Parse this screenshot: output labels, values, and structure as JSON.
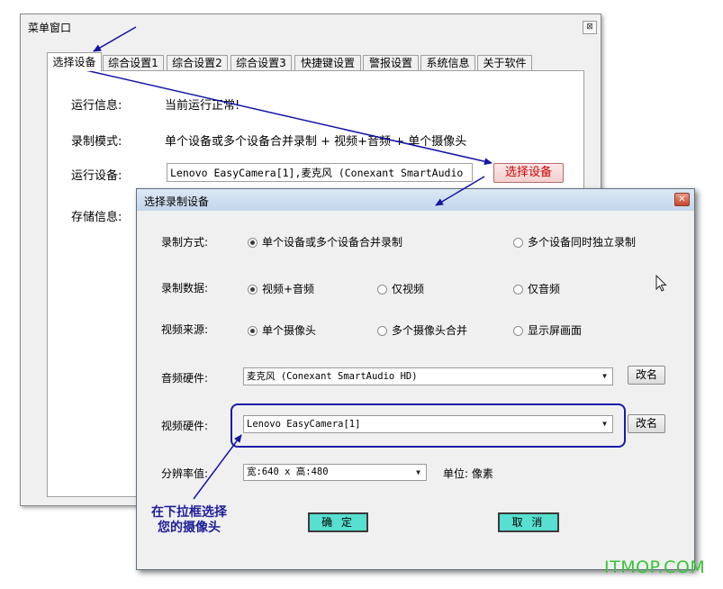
{
  "main_window": {
    "title": "菜单窗口",
    "close_glyph": "⊠",
    "tabs": [
      "选择设备",
      "综合设置1",
      "综合设置2",
      "综合设置3",
      "快捷键设置",
      "警报设置",
      "系统信息",
      "关于软件"
    ],
    "active_tab": "选择设备",
    "rows": {
      "run_info_label": "运行信息:",
      "run_info_value": "当前运行正常!",
      "record_mode_label": "录制模式:",
      "record_mode_value": "单个设备或多个设备合并录制 + 视频+音频 + 单个摄像头",
      "run_device_label": "运行设备:",
      "run_device_value": "Lenovo EasyCamera[1],麦克风 (Conexant SmartAudio",
      "storage_label": "存储信息:"
    },
    "select_device_button": "选择设备"
  },
  "dialog": {
    "title": "选择录制设备",
    "close_glyph": "✕",
    "record_method": {
      "label": "录制方式:",
      "options": [
        "单个设备或多个设备合并录制",
        "多个设备同时独立录制"
      ],
      "selected": 0
    },
    "record_data": {
      "label": "录制数据:",
      "options": [
        "视频+音频",
        "仅视频",
        "仅音频"
      ],
      "selected": 0
    },
    "video_source": {
      "label": "视频来源:",
      "options": [
        "单个摄像头",
        "多个摄像头合并",
        "显示屏画面"
      ],
      "selected": 0
    },
    "audio_hw": {
      "label": "音频硬件:",
      "value": "麦克风 (Conexant SmartAudio HD)",
      "rename": "改名"
    },
    "video_hw": {
      "label": "视频硬件:",
      "value": "Lenovo EasyCamera[1]",
      "rename": "改名"
    },
    "resolution": {
      "label": "分辨率值:",
      "value": "宽:640 x 高:480",
      "unit_label": "单位: 像素"
    },
    "ok_button": "确 定",
    "cancel_button": "取 消"
  },
  "annotation": {
    "callout_line1": "在下拉框选择",
    "callout_line2": "您的摄像头",
    "arrow_color": "#1414a8"
  },
  "watermark": "ITMOP.COM",
  "colors": {
    "select_btn_text": "#d00000",
    "action_btn_bg": "#57e0d0",
    "highlight_border": "#1a1aa8",
    "watermark": "#38c538"
  }
}
